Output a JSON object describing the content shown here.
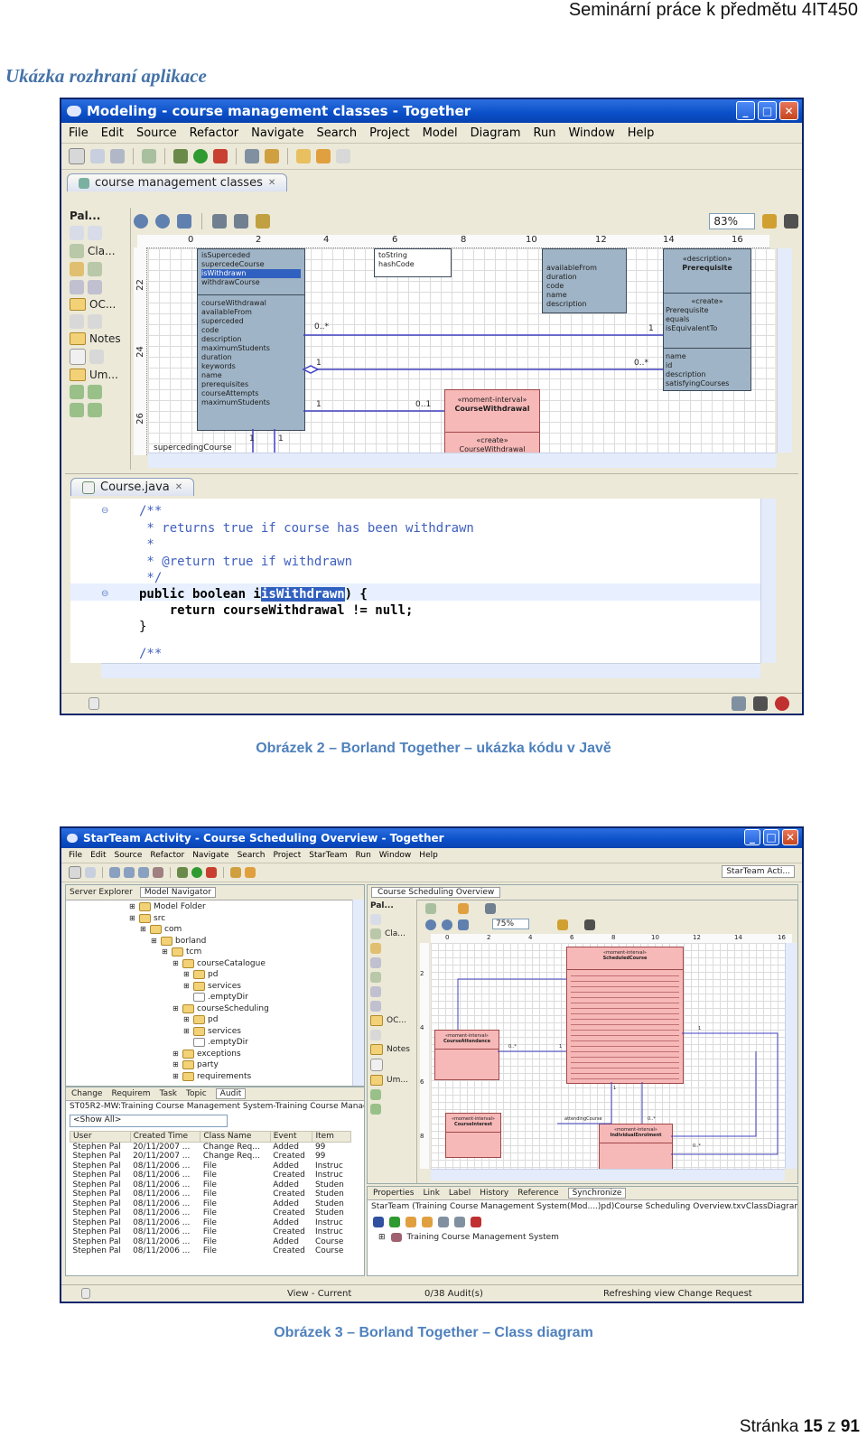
{
  "header": {
    "right": "Seminární práce k předmětu 4IT450"
  },
  "section": {
    "heading": "Ukázka rozhraní aplikace"
  },
  "figure1": {
    "title": "Modeling - course management classes - Together",
    "menu": [
      "File",
      "Edit",
      "Source",
      "Refactor",
      "Navigate",
      "Search",
      "Project",
      "Model",
      "Diagram",
      "Run",
      "Window",
      "Help"
    ],
    "diagram_tab": "course management classes",
    "zoom": "83%",
    "palette": [
      "Pal...",
      "Cla...",
      "OC...",
      "Notes",
      "Um..."
    ],
    "ruler_top": [
      "0",
      "2",
      "4",
      "6",
      "8",
      "10",
      "12",
      "14",
      "16"
    ],
    "ruler_left": [
      "22",
      "24",
      "26"
    ],
    "class_a_top": [
      "isSuperceded",
      "supercedeCourse",
      "isWithdrawn",
      "withdrawCourse"
    ],
    "class_a_bottom": [
      "courseWithdrawal",
      "availableFrom",
      "superceded",
      "code",
      "description",
      "maximumStudents",
      "duration",
      "keywords",
      "name",
      "prerequisites",
      "courseAttempts",
      "maximumStudents"
    ],
    "class_b": [
      "toString",
      "hashCode"
    ],
    "class_c": [
      "availableFrom",
      "duration",
      "code",
      "name",
      "description"
    ],
    "prereq": {
      "stereotype": "«description»",
      "name": "Prerequisite",
      "create": "«create»",
      "method": "Prerequisite",
      "equals": "equals",
      "is": "isEquivalentTo",
      "attrs": [
        "name",
        "id",
        "description",
        "satisfyingCourses"
      ]
    },
    "withdrawal": {
      "stereotype": "«moment-interval»",
      "name": "CourseWithdrawal",
      "create": "«create»",
      "method": "CourseWithdrawal"
    },
    "mult": {
      "m1": "0..*",
      "m2": "1",
      "m3": "1",
      "m4": "0..*",
      "m5": "1",
      "m6": "0..1",
      "m7": "1",
      "m8": "1"
    },
    "assoc_label": "supercedingCourse",
    "editor_tab": "Course.java",
    "code_lines": [
      "/**",
      " * returns true if course has been withdrawn",
      " *",
      " * @return true if withdrawn",
      " */",
      "public boolean isWithdrawn() {",
      "    return courseWithdrawal != null;",
      "}",
      "/**"
    ],
    "highlight_word": "isWithdrawn"
  },
  "caption1": "Obrázek 2 – Borland Together – ukázka kódu v Javě",
  "figure2": {
    "title": "StarTeam Activity - Course Scheduling Overview - Together",
    "menu": [
      "File",
      "Edit",
      "Source",
      "Refactor",
      "Navigate",
      "Search",
      "Project",
      "StarTeam",
      "Run",
      "Window",
      "Help"
    ],
    "perspective": "StarTeam Acti...",
    "left_tabs": [
      "Server Explorer",
      "Model Navigator"
    ],
    "tree": [
      {
        "indent": 0,
        "label": "Model Folder"
      },
      {
        "indent": 0,
        "label": "src"
      },
      {
        "indent": 1,
        "label": "com"
      },
      {
        "indent": 2,
        "label": "borland"
      },
      {
        "indent": 3,
        "label": "tcm"
      },
      {
        "indent": 4,
        "label": "courseCatalogue"
      },
      {
        "indent": 5,
        "label": "pd"
      },
      {
        "indent": 5,
        "label": "services"
      },
      {
        "indent": 5,
        "label": ".emptyDir"
      },
      {
        "indent": 4,
        "label": "courseScheduling"
      },
      {
        "indent": 5,
        "label": "pd"
      },
      {
        "indent": 5,
        "label": "services"
      },
      {
        "indent": 5,
        "label": ".emptyDir"
      },
      {
        "indent": 4,
        "label": "exceptions"
      },
      {
        "indent": 4,
        "label": "party"
      },
      {
        "indent": 4,
        "label": "requirements"
      }
    ],
    "bottom_tabs": [
      "Change",
      "Requirem",
      "Task",
      "Topic",
      "Audit"
    ],
    "audit_path": "ST05R2-MW:Training Course Management System-Training Course Manag",
    "filter": "<Show All>",
    "audit_columns": [
      "User",
      "Created Time",
      "Class Name",
      "Event",
      "Item"
    ],
    "audit_rows": [
      [
        "Stephen Pal",
        "20/11/2007 ...",
        "Change Req...",
        "Added",
        "99"
      ],
      [
        "Stephen Pal",
        "20/11/2007 ...",
        "Change Req...",
        "Created",
        "99"
      ],
      [
        "Stephen Pal",
        "08/11/2006 ...",
        "File",
        "Added",
        "Instruc"
      ],
      [
        "Stephen Pal",
        "08/11/2006 ...",
        "File",
        "Created",
        "Instruc"
      ],
      [
        "Stephen Pal",
        "08/11/2006 ...",
        "File",
        "Added",
        "Studen"
      ],
      [
        "Stephen Pal",
        "08/11/2006 ...",
        "File",
        "Created",
        "Studen"
      ],
      [
        "Stephen Pal",
        "08/11/2006 ...",
        "File",
        "Added",
        "Studen"
      ],
      [
        "Stephen Pal",
        "08/11/2006 ...",
        "File",
        "Created",
        "Studen"
      ],
      [
        "Stephen Pal",
        "08/11/2006 ...",
        "File",
        "Added",
        "Instruc"
      ],
      [
        "Stephen Pal",
        "08/11/2006 ...",
        "File",
        "Created",
        "Instruc"
      ],
      [
        "Stephen Pal",
        "08/11/2006 ...",
        "File",
        "Added",
        "Course"
      ],
      [
        "Stephen Pal",
        "08/11/2006 ...",
        "File",
        "Created",
        "Course"
      ]
    ],
    "diagram_tab": "Course Scheduling Overview",
    "zoom": "75%",
    "palette": [
      "Pal...",
      "Cla...",
      "OC...",
      "Notes",
      "Um..."
    ],
    "ruler_top": [
      "0",
      "2",
      "4",
      "6",
      "8",
      "10",
      "12",
      "14",
      "16"
    ],
    "ruler_left": [
      "2",
      "4",
      "6",
      "8"
    ],
    "class_main": {
      "stereotype": "«moment-interval»",
      "name": "ScheduledCourse"
    },
    "class_attendance": {
      "stereotype": "«moment-interval»",
      "name": "CourseAttendance"
    },
    "class_interest": {
      "stereotype": "«moment-interval»",
      "name": "CourseInterest"
    },
    "class_enrolment": {
      "stereotype": "«moment-interval»",
      "name": "IndividualEnrolment"
    },
    "assoc_label": "attendingCourse",
    "mult": {
      "m1": "0..*",
      "m2": "1",
      "m3": "1",
      "m4": "1",
      "m5": "0..*",
      "m6": "0..*"
    },
    "prop_tabs": [
      "Properties",
      "Link",
      "Label",
      "History",
      "Reference",
      "Synchronize"
    ],
    "sync_path": "StarTeam (Training Course Management System(Mod....)pd)Course Scheduling Overview.txvClassDiagram20)",
    "sync_item": "Training Course Management System",
    "status": [
      "View - Current",
      "0/38 Audit(s)",
      "Refreshing view Change Request"
    ]
  },
  "caption2": "Obrázek 3 – Borland Together – Class diagram",
  "footer": {
    "prefix": "Stránka",
    "page": "15",
    "sep": "z",
    "total": "91"
  }
}
